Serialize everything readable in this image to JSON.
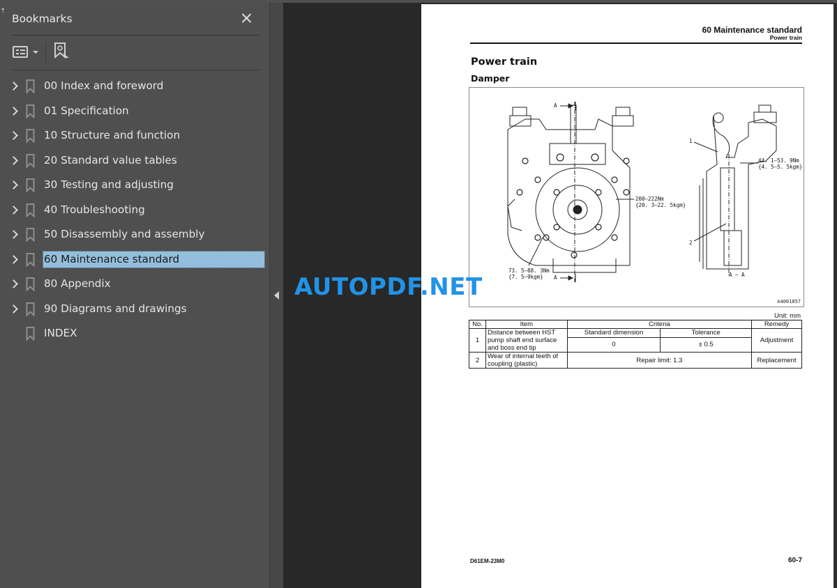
{
  "sidebar": {
    "title": "Bookmarks",
    "close_label": "Close",
    "tools": {
      "options_icon": "list-options-icon",
      "find_icon": "find-current-bookmark-icon"
    },
    "items": [
      {
        "label": "00 Index and foreword",
        "expandable": true,
        "selected": false
      },
      {
        "label": "01 Specification",
        "expandable": true,
        "selected": false
      },
      {
        "label": "10 Structure and function",
        "expandable": true,
        "selected": false
      },
      {
        "label": "20 Standard value tables",
        "expandable": true,
        "selected": false
      },
      {
        "label": "30 Testing and adjusting",
        "expandable": true,
        "selected": false
      },
      {
        "label": "40 Troubleshooting",
        "expandable": true,
        "selected": false
      },
      {
        "label": "50 Disassembly and assembly",
        "expandable": true,
        "selected": false
      },
      {
        "label": "60 Maintenance standard",
        "expandable": true,
        "selected": true
      },
      {
        "label": "80 Appendix",
        "expandable": true,
        "selected": false
      },
      {
        "label": "90 Diagrams and drawings",
        "expandable": true,
        "selected": false
      },
      {
        "label": "INDEX",
        "expandable": false,
        "selected": false
      }
    ]
  },
  "page": {
    "header_main": "60 Maintenance standard",
    "header_sub": "Power train",
    "section_title": "Power train",
    "subsection_title": "Damper",
    "figure": {
      "label_a_top": "A",
      "label_a_bottom": "A",
      "torque_center": "200–222Nm",
      "torque_center_kgm": "{20. 3–22. 5kgm}",
      "torque_bottom": "73. 5–88. 3Nm",
      "torque_bottom_kgm": "{7. 5–9kgm}",
      "torque_right": "44. 1–53. 9Nm",
      "torque_right_kgm": "{4. 5–5. 5kgm}",
      "callout_1": "1",
      "callout_2": "2",
      "section_label": "A – A",
      "drawing_code": "A4001857"
    },
    "unit": "Unit: mm",
    "table": {
      "headers": {
        "no": "No.",
        "item": "Item",
        "criteria": "Criteria",
        "remedy": "Remedy"
      },
      "sub_headers": {
        "standard": "Standard dimension",
        "tolerance": "Tolerance"
      },
      "rows": [
        {
          "no": "1",
          "item": "Distance between HST pump shaft end surface and boss end tip",
          "standard": "0",
          "tolerance": "± 0.5",
          "remedy": "Adjustment"
        },
        {
          "no": "2",
          "item": "Wear of internal teeth of coupling (plastic)",
          "criteria": "Repair limit: 1.3",
          "remedy": "Replacement"
        }
      ]
    },
    "footer_left": "D61EM-23M0",
    "footer_right": "60-7"
  },
  "watermark": "AUTOPDF.NET",
  "colors": {
    "sidebar_bg": "#4f4f4f",
    "selected_bg": "#94bfdc",
    "canvas_bg": "#282828",
    "watermark": "#2193e8"
  }
}
